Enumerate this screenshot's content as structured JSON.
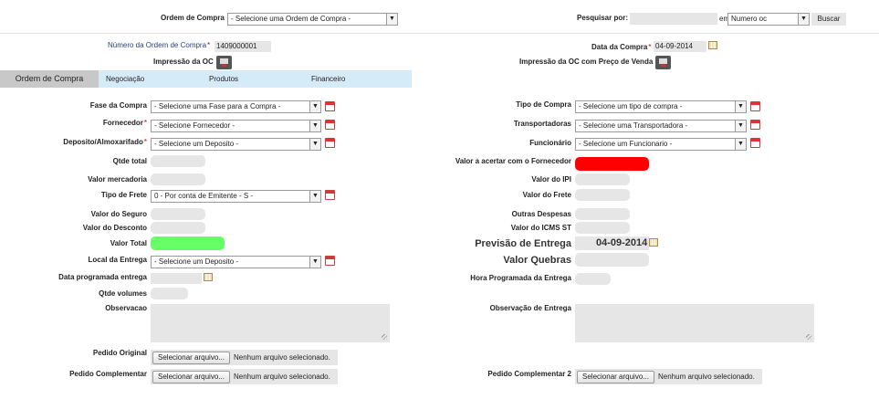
{
  "header": {
    "ordem_label": "Ordem de Compra",
    "ordem_select": "- Selecione uma Ordem de Compra -",
    "pesquisar_label": "Pesquisar por:",
    "em_label": "em",
    "search_field": "Numero oc",
    "buscar": "Buscar"
  },
  "top": {
    "numero_label": "Número da Ordem de Compra",
    "numero_value": "1409000001",
    "impressao_label": "Impressão da OC",
    "data_label": "Data da Compra",
    "data_value": "04-09-2014",
    "impressao_preco_label": "Impressão da OC com Preço de Venda"
  },
  "tabs": [
    "Ordem de Compra",
    "Negociação",
    "Produtos",
    "Financeiro"
  ],
  "left": {
    "fase_label": "Fase da Compra",
    "fase_select": "- Selecione uma Fase para a Compra -",
    "fornecedor_label": "Fornecedor",
    "fornecedor_select": "- Selecione Fornecedor -",
    "deposito_label": "Deposito/Almoxarifado",
    "deposito_select": "- Selecione um Deposito -",
    "qtde_total": "Qtde total",
    "valor_mercadoria": "Valor mercadoria",
    "tipo_frete_label": "Tipo de Frete",
    "tipo_frete_select": "0 - Por conta de Emitente - S -",
    "valor_seguro": "Valor do Seguro",
    "valor_desconto": "Valor do Desconto",
    "valor_total": "Valor Total",
    "local_entrega_label": "Local da Entrega",
    "local_entrega_select": "- Selecione um Deposito -",
    "data_programada": "Data programada entrega",
    "qtde_volumes": "Qtde volumes",
    "observacao": "Observacao",
    "pedido_original": "Pedido Original",
    "pedido_complementar": "Pedido Complementar",
    "file_button": "Selecionar arquivo...",
    "file_status": "Nenhum arquivo selecionado."
  },
  "right": {
    "tipo_compra_label": "Tipo de Compra",
    "tipo_compra_select": "- Selecione um tipo de compra -",
    "transportadoras_label": "Transportadoras",
    "transportadoras_select": "- Selecione uma Transportadora -",
    "funcionario_label": "Funcionário",
    "funcionario_select": "- Selecione um Funcionario -",
    "valor_acertar": "Valor a acertar com o Fornecedor",
    "valor_ipi": "Valor do IPI",
    "valor_frete": "Valor do Frete",
    "outras_despesas": "Outras Despesas",
    "valor_icms_st": "Valor do ICMS ST",
    "previsao_entrega": "Previsão de Entrega",
    "previsao_value": "04-09-2014",
    "valor_quebras": "Valor Quebras",
    "hora_programada": "Hora Programada da Entrega",
    "observacao_entrega": "Observação de Entrega",
    "pedido_complementar2": "Pedido Complementar 2",
    "file_button": "Selecionar arquivo...",
    "file_status": "Nenhum arquivo selecionado."
  },
  "colors": {
    "valor_acertar_bg": "#ff0000",
    "valor_total_bg": "#66ff66",
    "tabs_bg": "#d6ebf8",
    "active_tab_bg": "#c8c8c8"
  }
}
